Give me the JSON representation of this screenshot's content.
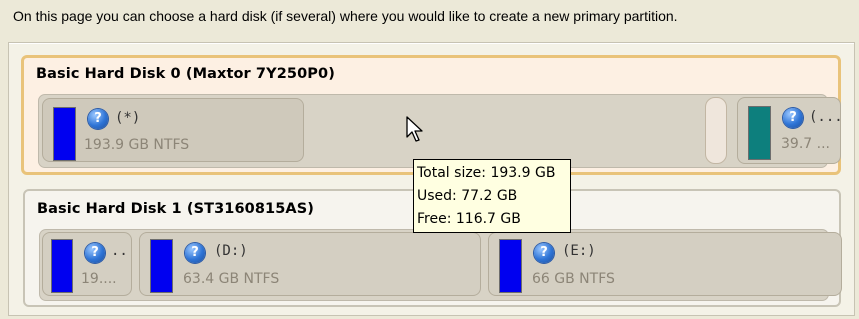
{
  "instruction": "On this page you can choose a hard disk (if several) where you would like to create a new primary partition.",
  "disks": [
    {
      "title": "Basic Hard Disk 0 (Maxtor 7Y250P0)",
      "partitions": [
        {
          "label": "(*)",
          "size": "193.9 GB NTFS",
          "color": "#0000f0"
        },
        {
          "label": "",
          "size": "",
          "color": ""
        },
        {
          "label": "(...",
          "size": "39.7 ...",
          "color": "#0d7f7d"
        }
      ]
    },
    {
      "title": "Basic Hard Disk 1 (ST3160815AS)",
      "partitions": [
        {
          "label": "..",
          "size": "19....",
          "color": "#0000f0"
        },
        {
          "label": "(D:)",
          "size": "63.4 GB NTFS",
          "color": "#0000f0"
        },
        {
          "label": "(E:)",
          "size": "66 GB NTFS",
          "color": "#0000f0"
        }
      ]
    }
  ],
  "tooltip": {
    "total": "Total size: 193.9 GB",
    "used": "Used: 77.2 GB",
    "free": "Free: 116.7 GB"
  },
  "icons": {
    "help": "?",
    "cursor": "arrow-cursor"
  }
}
